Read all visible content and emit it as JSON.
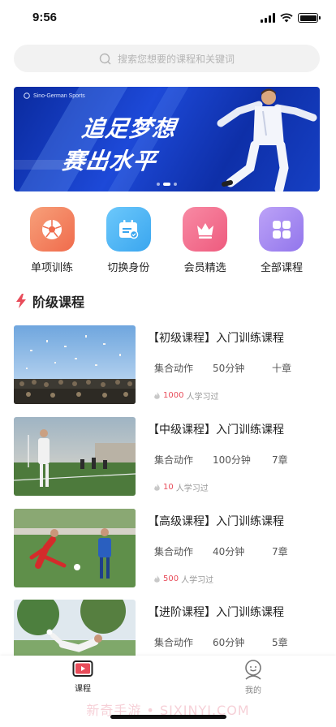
{
  "status": {
    "time": "9:56"
  },
  "search": {
    "placeholder": "搜索您想要的课程和关键词"
  },
  "banner": {
    "brand": "Sino-German Sports",
    "line1": "追足梦想",
    "line2": "赛出水平",
    "slides": 3,
    "active_slide": 2
  },
  "quick_menu": [
    {
      "label": "单项训练",
      "icon": "soccer-ball-icon",
      "color": "#f4845f"
    },
    {
      "label": "切换身份",
      "icon": "calendar-icon",
      "color": "#4ab3f4"
    },
    {
      "label": "会员精选",
      "icon": "crown-icon",
      "color": "#f26b8a"
    },
    {
      "label": "全部课程",
      "icon": "grid-icon",
      "color": "#a98bf0"
    }
  ],
  "section": {
    "title": "阶级课程",
    "accent": "#e84c5a"
  },
  "courses": [
    {
      "title": "【初级课程】入门训练课程",
      "type": "集合动作",
      "duration": "50分钟",
      "chapters": "十章",
      "learners": "1000",
      "learners_suffix": "人学习过"
    },
    {
      "title": "【中级课程】入门训练课程",
      "type": "集合动作",
      "duration": "100分钟",
      "chapters": "7章",
      "learners": "10",
      "learners_suffix": "人学习过"
    },
    {
      "title": "【高级课程】入门训练课程",
      "type": "集合动作",
      "duration": "40分钟",
      "chapters": "7章",
      "learners": "500",
      "learners_suffix": "人学习过"
    },
    {
      "title": "【进阶课程】入门训练课程",
      "type": "集合动作",
      "duration": "60分钟",
      "chapters": "5章",
      "learners": "",
      "learners_suffix": ""
    }
  ],
  "tabs": [
    {
      "label": "课程",
      "icon": "video-course-icon",
      "active": true
    },
    {
      "label": "我的",
      "icon": "profile-icon",
      "active": false
    }
  ],
  "watermark": "新奇手游 • SIXINYI.COM",
  "colors": {
    "accent_red": "#e84c5a",
    "active_tab": "#222222",
    "inactive_tab": "#888888"
  }
}
